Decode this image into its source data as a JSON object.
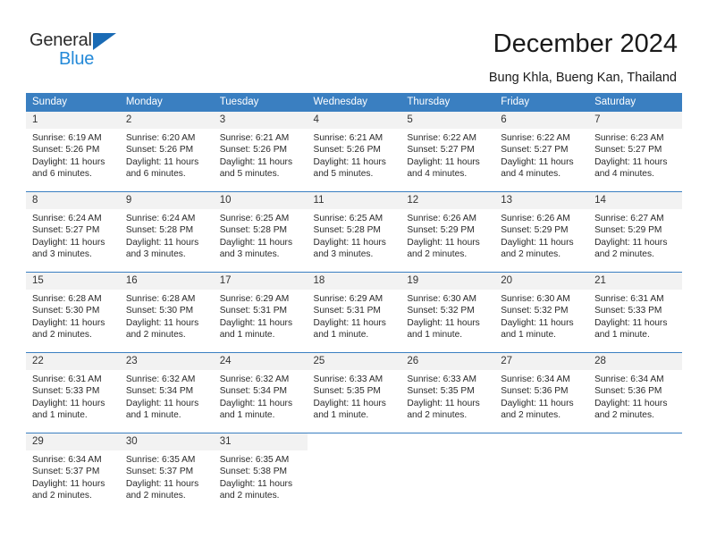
{
  "logo": {
    "word_one": "General",
    "word_two": "Blue",
    "triangle_color": "#1a6bb5",
    "blue_color": "#2389d8"
  },
  "header": {
    "title": "December 2024",
    "subtitle": "Bung Khla, Bueng Kan, Thailand",
    "accent_color": "#3a7fc1",
    "daynum_band_color": "#f2f2f2"
  },
  "weekdays": [
    "Sunday",
    "Monday",
    "Tuesday",
    "Wednesday",
    "Thursday",
    "Friday",
    "Saturday"
  ],
  "weeks": [
    [
      {
        "day": "1",
        "sunrise": "Sunrise: 6:19 AM",
        "sunset": "Sunset: 5:26 PM",
        "daylight": "Daylight: 11 hours and 6 minutes."
      },
      {
        "day": "2",
        "sunrise": "Sunrise: 6:20 AM",
        "sunset": "Sunset: 5:26 PM",
        "daylight": "Daylight: 11 hours and 6 minutes."
      },
      {
        "day": "3",
        "sunrise": "Sunrise: 6:21 AM",
        "sunset": "Sunset: 5:26 PM",
        "daylight": "Daylight: 11 hours and 5 minutes."
      },
      {
        "day": "4",
        "sunrise": "Sunrise: 6:21 AM",
        "sunset": "Sunset: 5:26 PM",
        "daylight": "Daylight: 11 hours and 5 minutes."
      },
      {
        "day": "5",
        "sunrise": "Sunrise: 6:22 AM",
        "sunset": "Sunset: 5:27 PM",
        "daylight": "Daylight: 11 hours and 4 minutes."
      },
      {
        "day": "6",
        "sunrise": "Sunrise: 6:22 AM",
        "sunset": "Sunset: 5:27 PM",
        "daylight": "Daylight: 11 hours and 4 minutes."
      },
      {
        "day": "7",
        "sunrise": "Sunrise: 6:23 AM",
        "sunset": "Sunset: 5:27 PM",
        "daylight": "Daylight: 11 hours and 4 minutes."
      }
    ],
    [
      {
        "day": "8",
        "sunrise": "Sunrise: 6:24 AM",
        "sunset": "Sunset: 5:27 PM",
        "daylight": "Daylight: 11 hours and 3 minutes."
      },
      {
        "day": "9",
        "sunrise": "Sunrise: 6:24 AM",
        "sunset": "Sunset: 5:28 PM",
        "daylight": "Daylight: 11 hours and 3 minutes."
      },
      {
        "day": "10",
        "sunrise": "Sunrise: 6:25 AM",
        "sunset": "Sunset: 5:28 PM",
        "daylight": "Daylight: 11 hours and 3 minutes."
      },
      {
        "day": "11",
        "sunrise": "Sunrise: 6:25 AM",
        "sunset": "Sunset: 5:28 PM",
        "daylight": "Daylight: 11 hours and 3 minutes."
      },
      {
        "day": "12",
        "sunrise": "Sunrise: 6:26 AM",
        "sunset": "Sunset: 5:29 PM",
        "daylight": "Daylight: 11 hours and 2 minutes."
      },
      {
        "day": "13",
        "sunrise": "Sunrise: 6:26 AM",
        "sunset": "Sunset: 5:29 PM",
        "daylight": "Daylight: 11 hours and 2 minutes."
      },
      {
        "day": "14",
        "sunrise": "Sunrise: 6:27 AM",
        "sunset": "Sunset: 5:29 PM",
        "daylight": "Daylight: 11 hours and 2 minutes."
      }
    ],
    [
      {
        "day": "15",
        "sunrise": "Sunrise: 6:28 AM",
        "sunset": "Sunset: 5:30 PM",
        "daylight": "Daylight: 11 hours and 2 minutes."
      },
      {
        "day": "16",
        "sunrise": "Sunrise: 6:28 AM",
        "sunset": "Sunset: 5:30 PM",
        "daylight": "Daylight: 11 hours and 2 minutes."
      },
      {
        "day": "17",
        "sunrise": "Sunrise: 6:29 AM",
        "sunset": "Sunset: 5:31 PM",
        "daylight": "Daylight: 11 hours and 1 minute."
      },
      {
        "day": "18",
        "sunrise": "Sunrise: 6:29 AM",
        "sunset": "Sunset: 5:31 PM",
        "daylight": "Daylight: 11 hours and 1 minute."
      },
      {
        "day": "19",
        "sunrise": "Sunrise: 6:30 AM",
        "sunset": "Sunset: 5:32 PM",
        "daylight": "Daylight: 11 hours and 1 minute."
      },
      {
        "day": "20",
        "sunrise": "Sunrise: 6:30 AM",
        "sunset": "Sunset: 5:32 PM",
        "daylight": "Daylight: 11 hours and 1 minute."
      },
      {
        "day": "21",
        "sunrise": "Sunrise: 6:31 AM",
        "sunset": "Sunset: 5:33 PM",
        "daylight": "Daylight: 11 hours and 1 minute."
      }
    ],
    [
      {
        "day": "22",
        "sunrise": "Sunrise: 6:31 AM",
        "sunset": "Sunset: 5:33 PM",
        "daylight": "Daylight: 11 hours and 1 minute."
      },
      {
        "day": "23",
        "sunrise": "Sunrise: 6:32 AM",
        "sunset": "Sunset: 5:34 PM",
        "daylight": "Daylight: 11 hours and 1 minute."
      },
      {
        "day": "24",
        "sunrise": "Sunrise: 6:32 AM",
        "sunset": "Sunset: 5:34 PM",
        "daylight": "Daylight: 11 hours and 1 minute."
      },
      {
        "day": "25",
        "sunrise": "Sunrise: 6:33 AM",
        "sunset": "Sunset: 5:35 PM",
        "daylight": "Daylight: 11 hours and 1 minute."
      },
      {
        "day": "26",
        "sunrise": "Sunrise: 6:33 AM",
        "sunset": "Sunset: 5:35 PM",
        "daylight": "Daylight: 11 hours and 2 minutes."
      },
      {
        "day": "27",
        "sunrise": "Sunrise: 6:34 AM",
        "sunset": "Sunset: 5:36 PM",
        "daylight": "Daylight: 11 hours and 2 minutes."
      },
      {
        "day": "28",
        "sunrise": "Sunrise: 6:34 AM",
        "sunset": "Sunset: 5:36 PM",
        "daylight": "Daylight: 11 hours and 2 minutes."
      }
    ],
    [
      {
        "day": "29",
        "sunrise": "Sunrise: 6:34 AM",
        "sunset": "Sunset: 5:37 PM",
        "daylight": "Daylight: 11 hours and 2 minutes."
      },
      {
        "day": "30",
        "sunrise": "Sunrise: 6:35 AM",
        "sunset": "Sunset: 5:37 PM",
        "daylight": "Daylight: 11 hours and 2 minutes."
      },
      {
        "day": "31",
        "sunrise": "Sunrise: 6:35 AM",
        "sunset": "Sunset: 5:38 PM",
        "daylight": "Daylight: 11 hours and 2 minutes."
      },
      {
        "day": "",
        "sunrise": "",
        "sunset": "",
        "daylight": ""
      },
      {
        "day": "",
        "sunrise": "",
        "sunset": "",
        "daylight": ""
      },
      {
        "day": "",
        "sunrise": "",
        "sunset": "",
        "daylight": ""
      },
      {
        "day": "",
        "sunrise": "",
        "sunset": "",
        "daylight": ""
      }
    ]
  ]
}
